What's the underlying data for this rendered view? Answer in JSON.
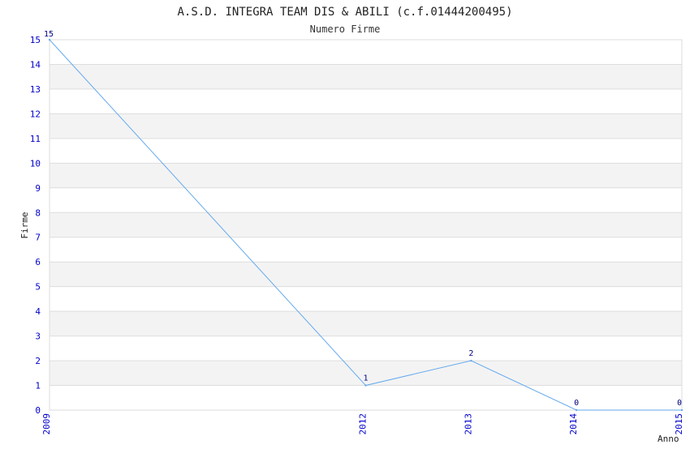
{
  "chart_data": {
    "type": "line",
    "title": "A.S.D. INTEGRA TEAM DIS & ABILI (c.f.01444200495)",
    "subtitle": "Numero Firme",
    "xlabel": "Anno",
    "ylabel": "Firme",
    "categories": [
      "2009",
      "2012",
      "2013",
      "2014",
      "2015"
    ],
    "series": [
      {
        "values": [
          15,
          1,
          2,
          0,
          0
        ]
      }
    ],
    "data_labels": [
      "15",
      "1",
      "2",
      "0",
      "0"
    ],
    "ylim": [
      0,
      15
    ],
    "yticks": [
      "0",
      "1",
      "2",
      "3",
      "4",
      "5",
      "6",
      "7",
      "8",
      "9",
      "10",
      "11",
      "12",
      "13",
      "14",
      "15"
    ],
    "grid": true,
    "legend": "none",
    "colors": {
      "line": "#66aaee",
      "band": "#f3f3f3",
      "grid": "#dddddd",
      "tick_text": "#0000cc",
      "data_label": "#000080"
    }
  }
}
